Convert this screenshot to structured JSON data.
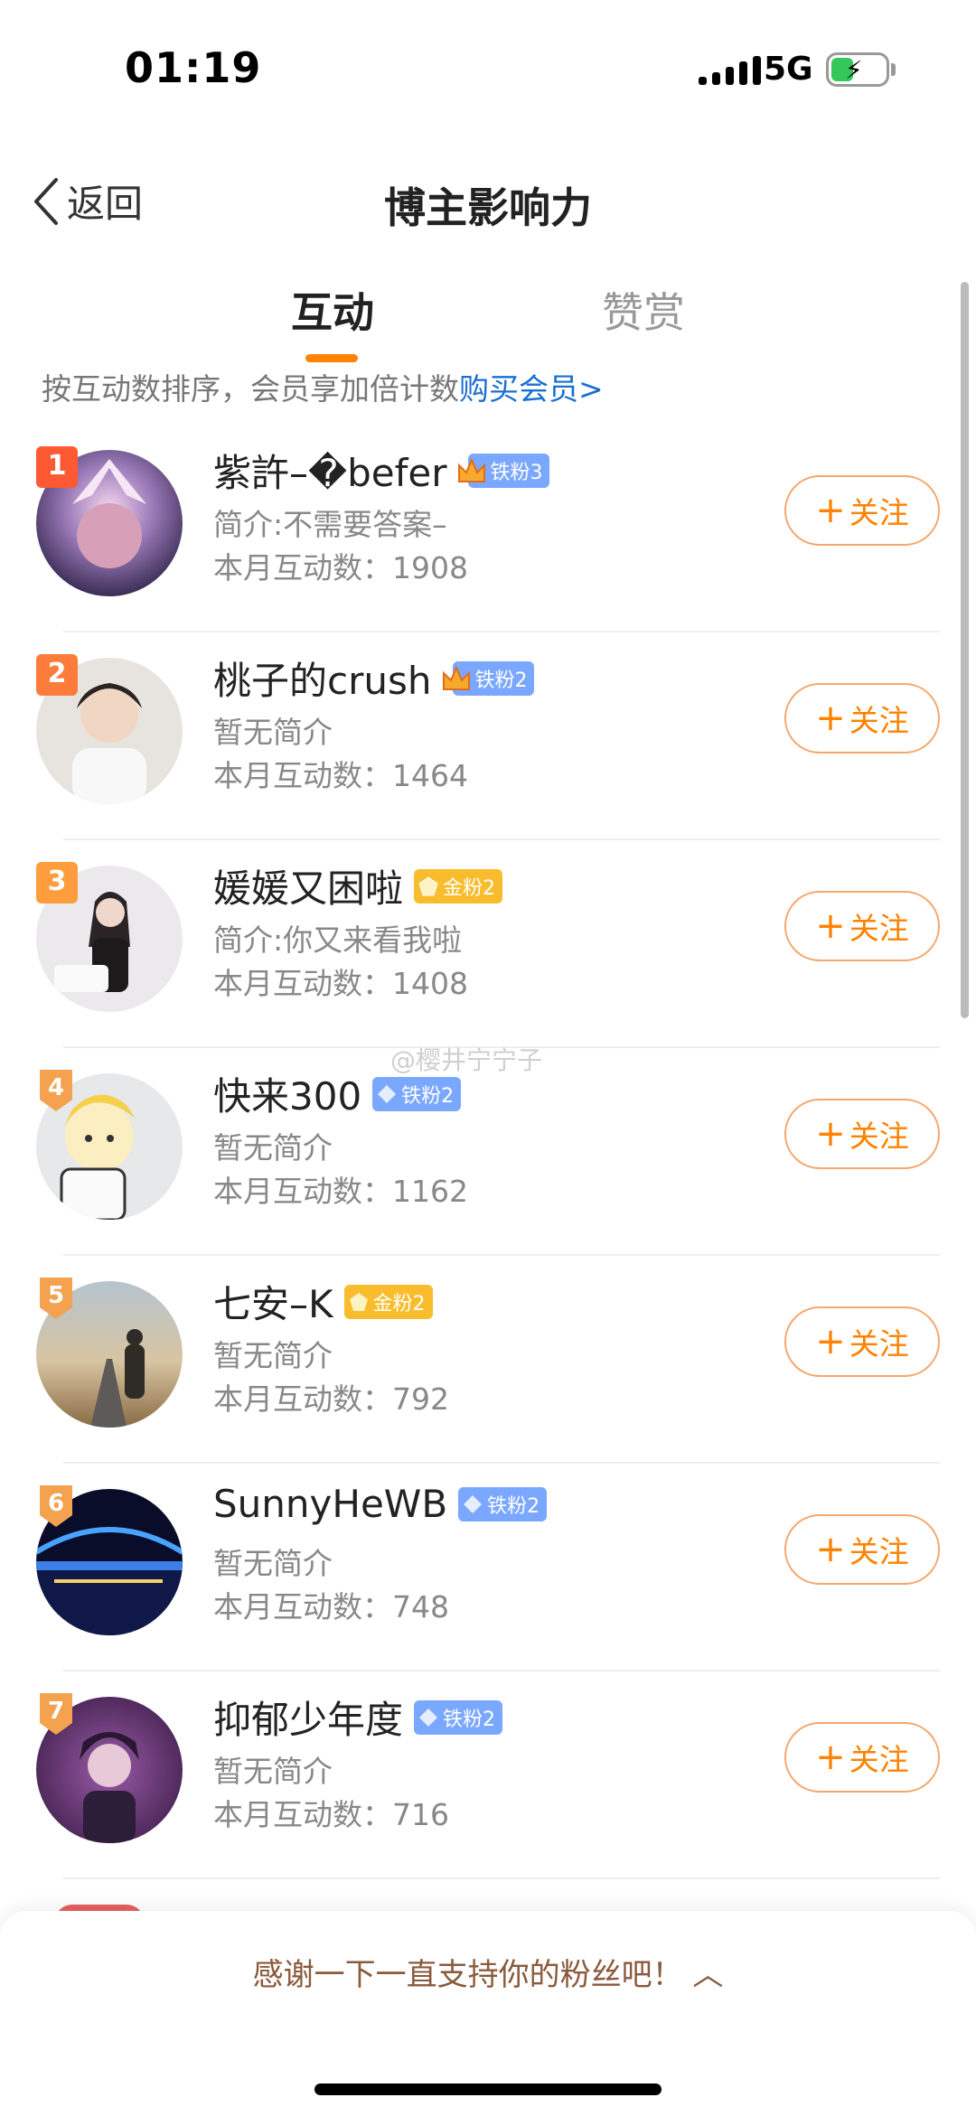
{
  "status_bar": {
    "time": "01:19",
    "network": "5G"
  },
  "header": {
    "back_label": "返回",
    "title": "博主影响力"
  },
  "tabs": [
    {
      "label": "互动"
    },
    {
      "label": "赞赏"
    }
  ],
  "hint": {
    "text": "按互动数排序，会员享加倍计数",
    "link": "购买会员>"
  },
  "follow_label": "关注",
  "watermark": "@樱井宁宁子",
  "users": [
    {
      "rank": "1",
      "name": "紫許–�befer",
      "badge": "铁粉3",
      "intro": "简介:不需要答案–",
      "count": "本月互动数：1908"
    },
    {
      "rank": "2",
      "name": "桃子的crush",
      "badge": "铁粉2",
      "intro": "暂无简介",
      "count": "本月互动数：1464"
    },
    {
      "rank": "3",
      "name": "媛媛又困啦",
      "badge": "金粉2",
      "intro": "简介:你又来看我啦",
      "count": "本月互动数：1408"
    },
    {
      "rank": "4",
      "name": "快来300",
      "badge": "铁粉2",
      "intro": "暂无简介",
      "count": "本月互动数：1162"
    },
    {
      "rank": "5",
      "name": "七安–K",
      "badge": "金粉2",
      "intro": "暂无简介",
      "count": "本月互动数：792"
    },
    {
      "rank": "6",
      "name": "SunnyHeWB",
      "badge": "铁粉2",
      "intro": "暂无简介",
      "count": "本月互动数：748"
    },
    {
      "rank": "7",
      "name": "抑郁少年度",
      "badge": "铁粉2",
      "intro": "暂无简介",
      "count": "本月互动数：716"
    }
  ],
  "bottom_sheet": {
    "text": "感谢一下一直支持你的粉丝吧！ ︿"
  }
}
